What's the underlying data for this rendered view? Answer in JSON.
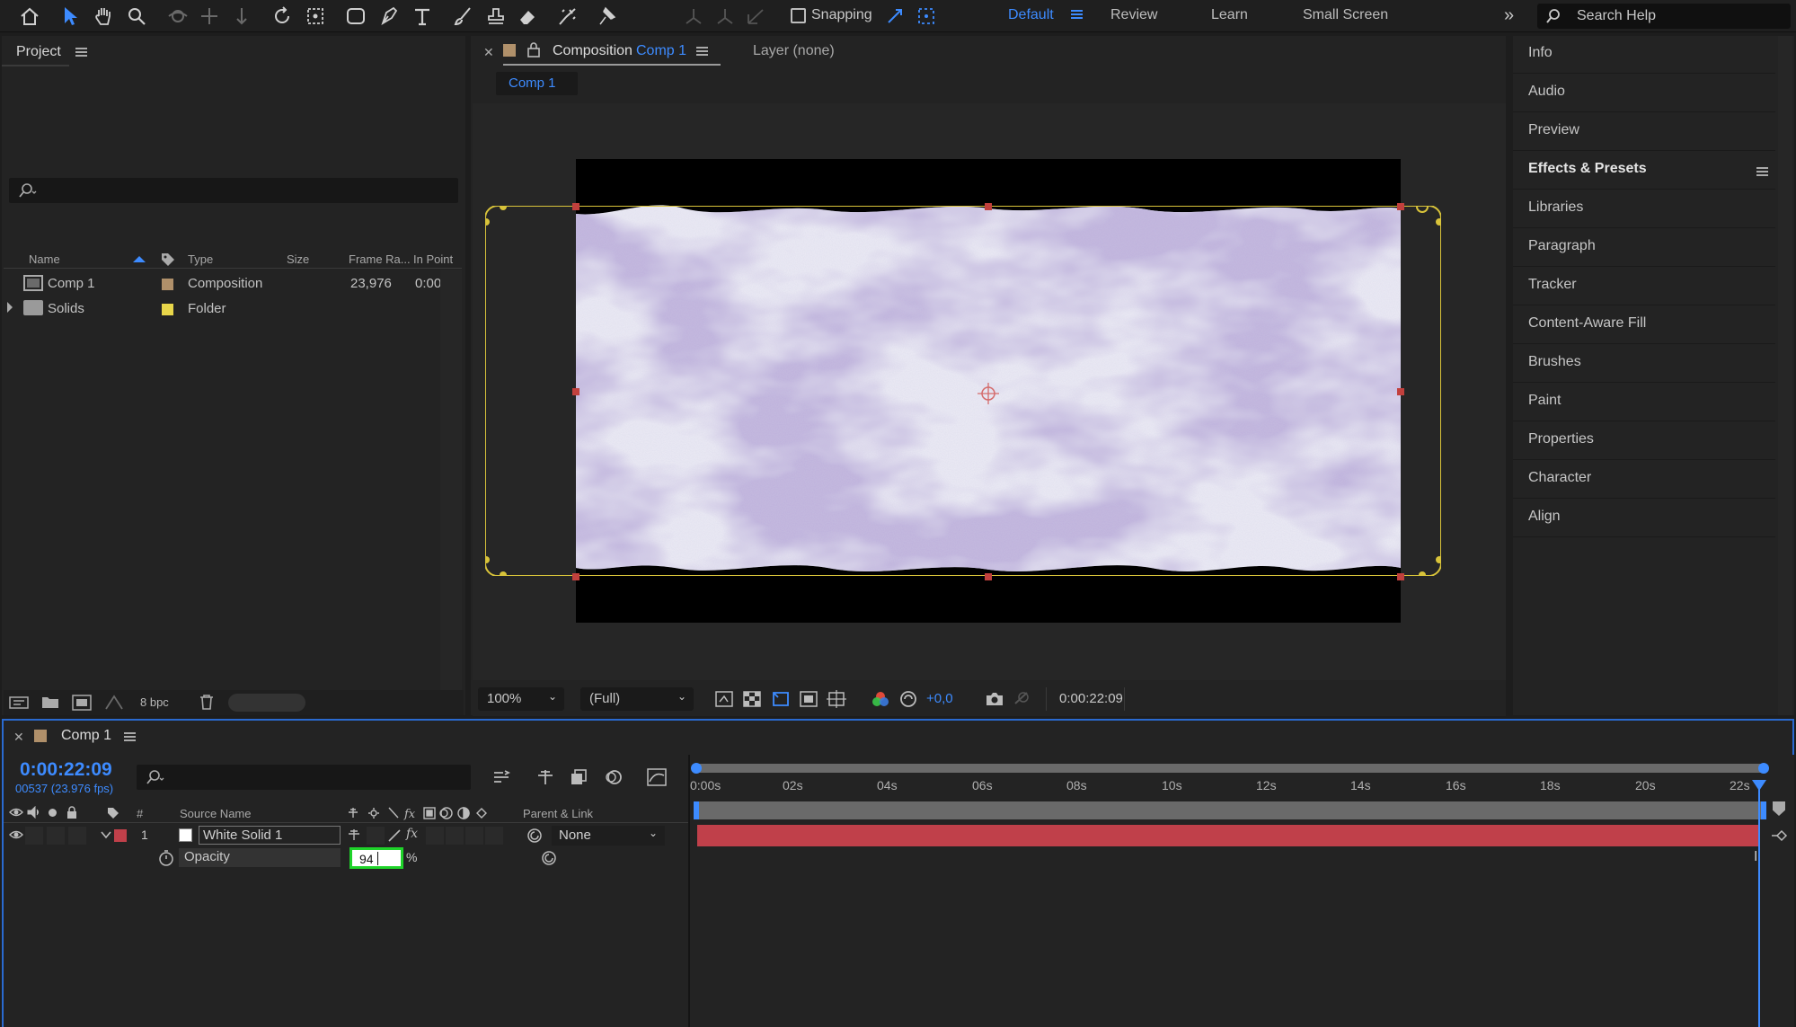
{
  "toolbar": {
    "snapping_label": "Snapping",
    "workspaces": [
      "Default",
      "Review",
      "Learn",
      "Small Screen"
    ],
    "search_placeholder": "Search Help"
  },
  "project": {
    "title": "Project",
    "columns": [
      "Name",
      "Type",
      "Size",
      "Frame Ra...",
      "In Point"
    ],
    "items": [
      {
        "name": "Comp 1",
        "type": "Composition",
        "frame_rate": "23,976",
        "in_point": "0:00",
        "label_color": "#b0906a"
      },
      {
        "name": "Solids",
        "type": "Folder",
        "frame_rate": "",
        "in_point": "",
        "label_color": "#e8d64a"
      }
    ],
    "bpc": "8 bpc"
  },
  "composition": {
    "tab_title": "Composition",
    "tab_comp": "Comp 1",
    "layer_tab": "Layer (none)",
    "breadcrumb": "Comp 1",
    "zoom": "100%",
    "resolution": "(Full)",
    "exposure": "+0,0",
    "timecode": "0:00:22:09"
  },
  "right_panels": [
    "Info",
    "Audio",
    "Preview",
    "Effects & Presets",
    "Libraries",
    "Paragraph",
    "Tracker",
    "Content-Aware Fill",
    "Brushes",
    "Paint",
    "Properties",
    "Character",
    "Align"
  ],
  "timeline": {
    "tab": "Comp 1",
    "timecode": "0:00:22:09",
    "frames_info": "00537 (23.976 fps)",
    "col_hash": "#",
    "col_source": "Source Name",
    "col_parent": "Parent & Link",
    "layer_number": "1",
    "layer_name": "White Solid 1",
    "parent_value": "None",
    "property_name": "Opacity",
    "property_value": "94",
    "property_unit": "%",
    "ticks": [
      "0:00s",
      "02s",
      "04s",
      "06s",
      "08s",
      "10s",
      "12s",
      "14s",
      "16s",
      "18s",
      "20s",
      "22s"
    ],
    "layer_color": "#c0404a"
  }
}
